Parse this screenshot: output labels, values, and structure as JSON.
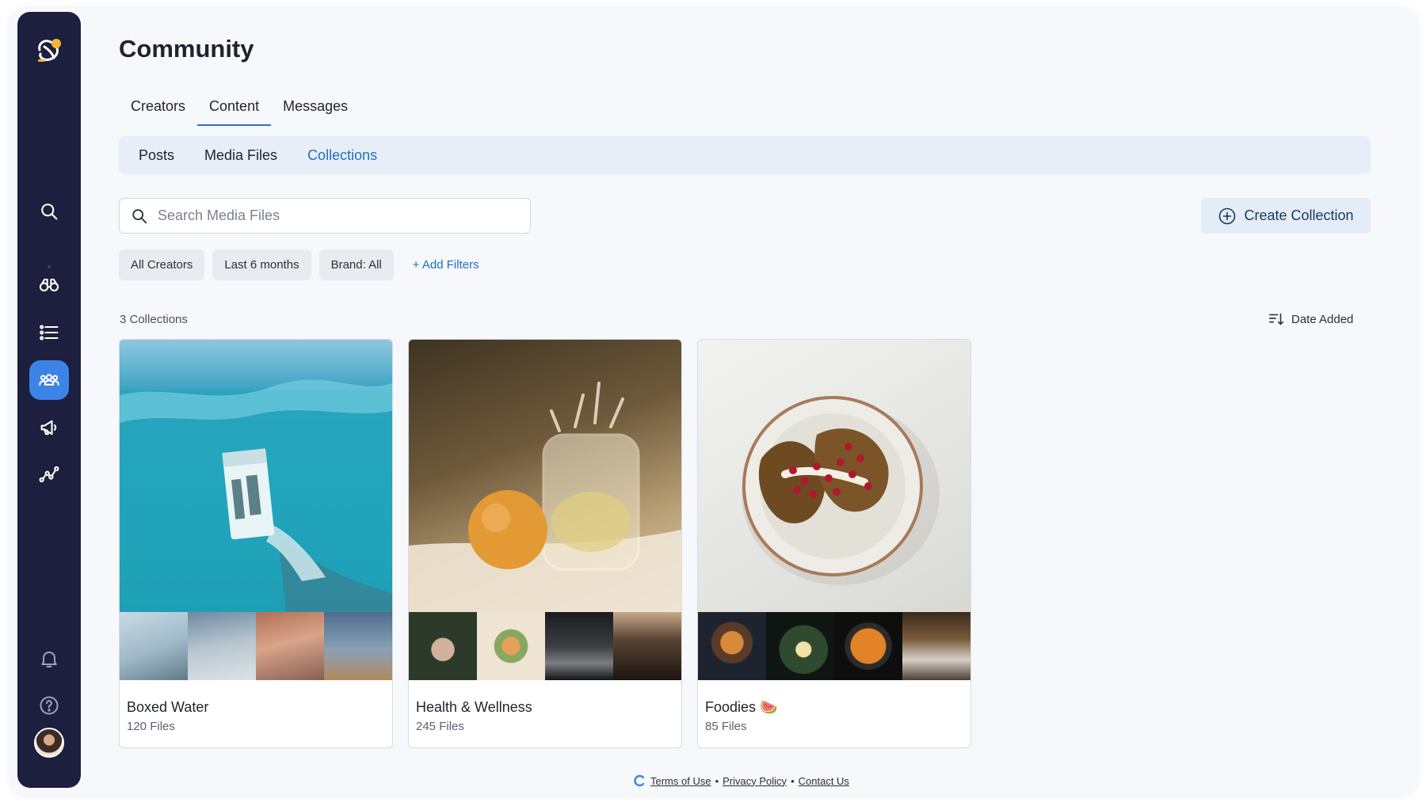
{
  "page": {
    "title": "Community"
  },
  "tabs": [
    {
      "label": "Creators"
    },
    {
      "label": "Content",
      "active": true
    },
    {
      "label": "Messages"
    }
  ],
  "subtabs": [
    {
      "label": "Posts"
    },
    {
      "label": "Media Files"
    },
    {
      "label": "Collections",
      "active": true
    }
  ],
  "search": {
    "placeholder": "Search Media Files",
    "value": ""
  },
  "create_button": {
    "label": "Create Collection",
    "icon": "plus-circle-icon"
  },
  "filters": {
    "chips": [
      "All Creators",
      "Last 6 months",
      "Brand: All"
    ],
    "add_label": "+ Add Filters"
  },
  "collections_count": "3 Collections",
  "sort": {
    "label": "Date Added",
    "icon": "sort-icon"
  },
  "collections": [
    {
      "name": "Boxed Water",
      "files": "120 Files"
    },
    {
      "name": "Health & Wellness",
      "files": "245 Files"
    },
    {
      "name": "Foodies 🍉",
      "files": "85 Files"
    }
  ],
  "sidebar": {
    "items": [
      "search-icon",
      "binoculars-icon",
      "list-icon",
      "community-icon",
      "megaphone-icon",
      "analytics-icon",
      "bell-icon",
      "help-icon"
    ],
    "active": "community-icon"
  },
  "footer": {
    "links": [
      "Terms of Use",
      "Privacy Policy",
      "Contact Us"
    ],
    "separator": "•"
  },
  "colors": {
    "sidebar_bg": "#1d1f3f",
    "accent": "#3d83e6",
    "link": "#1f6fbf",
    "subtab_bg": "#e7eef7"
  }
}
